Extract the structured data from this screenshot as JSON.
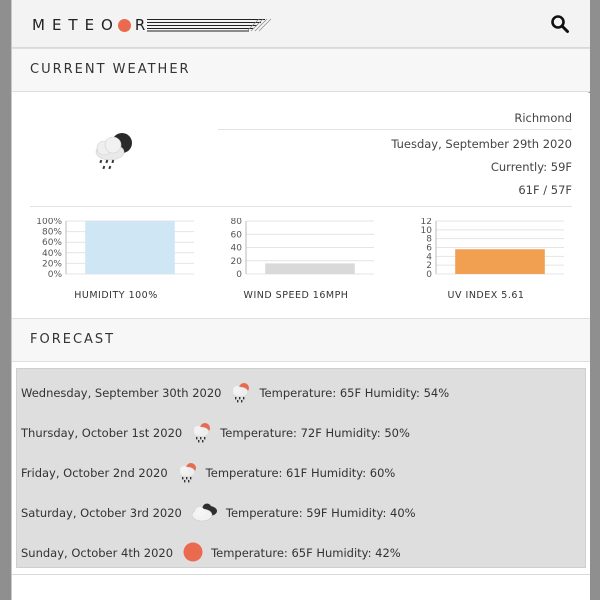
{
  "app": {
    "logo_text": "METEO",
    "logo_tail": "R",
    "brand_color": "#e96a4f"
  },
  "navbar": {
    "search_icon": "search-icon"
  },
  "current": {
    "heading": "CURRENT WEATHER",
    "icon": "night-rain-icon",
    "location": "Richmond",
    "date": "Tuesday, September 29th 2020",
    "currently": "Currently: 59F",
    "high_low": "61F / 57F",
    "gauges": [
      {
        "label": "HUMIDITY 100%",
        "value": 100,
        "ticks": [
          "100%",
          "80%",
          "60%",
          "40%",
          "20%",
          "0%"
        ],
        "max": 100,
        "color": "#cfe6f4"
      },
      {
        "label": "WIND SPEED 16MPH",
        "value": 16,
        "ticks": [
          "80",
          "60",
          "40",
          "20",
          "0"
        ],
        "max": 80,
        "color": "#d9d9d9"
      },
      {
        "label": "UV INDEX 5.61",
        "value": 5.61,
        "ticks": [
          "12",
          "10",
          "8",
          "6",
          "4",
          "2",
          "0"
        ],
        "max": 12,
        "color": "#f0a050"
      }
    ]
  },
  "forecast": {
    "heading": "FORECAST",
    "days": [
      {
        "date": "Wednesday, September 30th 2020",
        "icon": "sun-rain-icon",
        "details": "Temperature: 65F Humidity: 54%"
      },
      {
        "date": "Thursday, October 1st 2020",
        "icon": "sun-rain-icon",
        "details": "Temperature: 72F Humidity: 50%"
      },
      {
        "date": "Friday, October 2nd 2020",
        "icon": "sun-rain-icon",
        "details": "Temperature: 61F Humidity: 60%"
      },
      {
        "date": "Saturday, October 3rd 2020",
        "icon": "cloudy-icon",
        "details": "Temperature: 59F Humidity: 40%"
      },
      {
        "date": "Sunday, October 4th 2020",
        "icon": "sun-icon",
        "details": "Temperature: 65F Humidity: 42%"
      }
    ]
  }
}
